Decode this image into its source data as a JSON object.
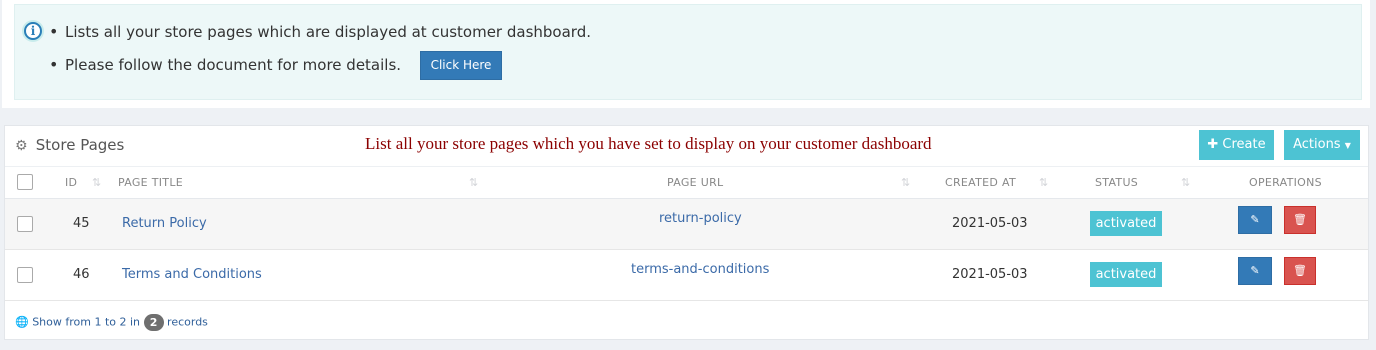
{
  "info": {
    "items": [
      "Lists all your store pages which are displayed at customer dashboard.",
      "Please follow the document for more details."
    ],
    "button_label": "Click Here",
    "icon": "info-icon"
  },
  "panel": {
    "title": "Store Pages",
    "note": "List all your store pages which you have set to display on your customer dashboard",
    "create_label": "Create",
    "actions_label": "Actions"
  },
  "table": {
    "headers": [
      "ID",
      "PAGE TITLE",
      "PAGE URL",
      "CREATED AT",
      "STATUS",
      "OPERATIONS"
    ],
    "rows": [
      {
        "id": "45",
        "title": "Return Policy",
        "url": "return-policy",
        "created_at": "2021-05-03",
        "status": "activated"
      },
      {
        "id": "46",
        "title": "Terms and Conditions",
        "url": "terms-and-conditions",
        "created_at": "2021-05-03",
        "status": "activated"
      }
    ]
  },
  "footer": {
    "prefix": "Show from 1 to 2 in",
    "count": "2",
    "suffix": "records"
  },
  "colors": {
    "primary": "#337ab7",
    "info": "#4dc3d3",
    "danger": "#d9534f",
    "note_red": "#8b0000"
  }
}
